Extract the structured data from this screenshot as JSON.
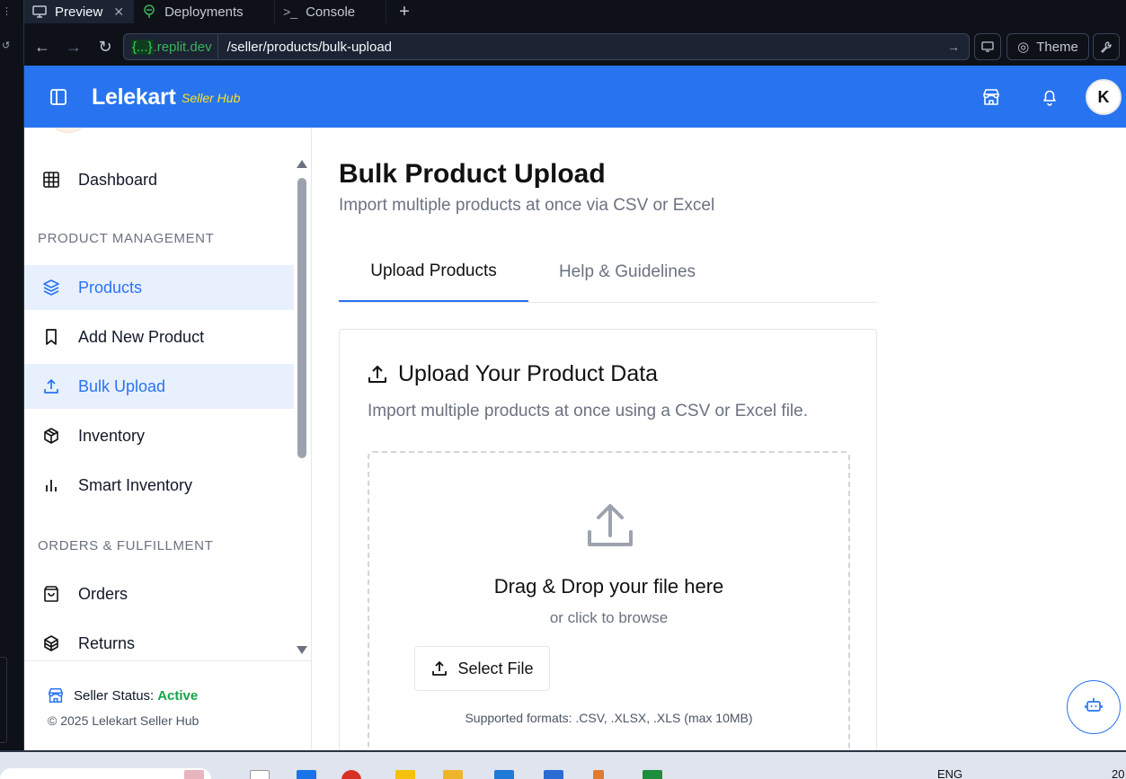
{
  "browser": {
    "tabs": [
      {
        "label": "Preview",
        "icon": "monitor-icon",
        "active": true
      },
      {
        "label": "Deployments",
        "icon": "deploy-icon",
        "active": false
      },
      {
        "label": "Console",
        "icon": "terminal-icon",
        "active": false
      }
    ],
    "url_domain_brace": "{...}",
    "url_domain": ".replit.dev",
    "url_path": "/seller/products/bulk-upload",
    "theme_label": "Theme"
  },
  "header": {
    "brand": "Lelekart",
    "brand_sub": "Seller Hub",
    "avatar_initial": "K",
    "accent": "#2874f0",
    "sub_color": "#ffe11b"
  },
  "sidebar": {
    "dashboard": "Dashboard",
    "section_product": "PRODUCT MANAGEMENT",
    "products": "Products",
    "add_new_product": "Add New Product",
    "bulk_upload": "Bulk Upload",
    "inventory": "Inventory",
    "smart_inventory": "Smart Inventory",
    "section_orders": "ORDERS & FULFILLMENT",
    "orders": "Orders",
    "returns": "Returns",
    "status_label": "Seller Status:",
    "status_value": "Active",
    "copyright": "© 2025 Lelekart Seller Hub"
  },
  "main": {
    "title": "Bulk Product Upload",
    "subtitle": "Import multiple products at once via CSV or Excel",
    "tabs": [
      {
        "label": "Upload Products",
        "active": true
      },
      {
        "label": "Help & Guidelines",
        "active": false
      }
    ],
    "card": {
      "title": "Upload Your Product Data",
      "description": "Import multiple products at once using a CSV or Excel file.",
      "drop_title": "Drag & Drop your file here",
      "drop_sub": "or click to browse",
      "select_button": "Select File",
      "formats": "Supported formats: .CSV, .XLSX, .XLS (max 10MB)"
    }
  },
  "taskbar": {
    "lang": "ENG",
    "clock": "20"
  }
}
